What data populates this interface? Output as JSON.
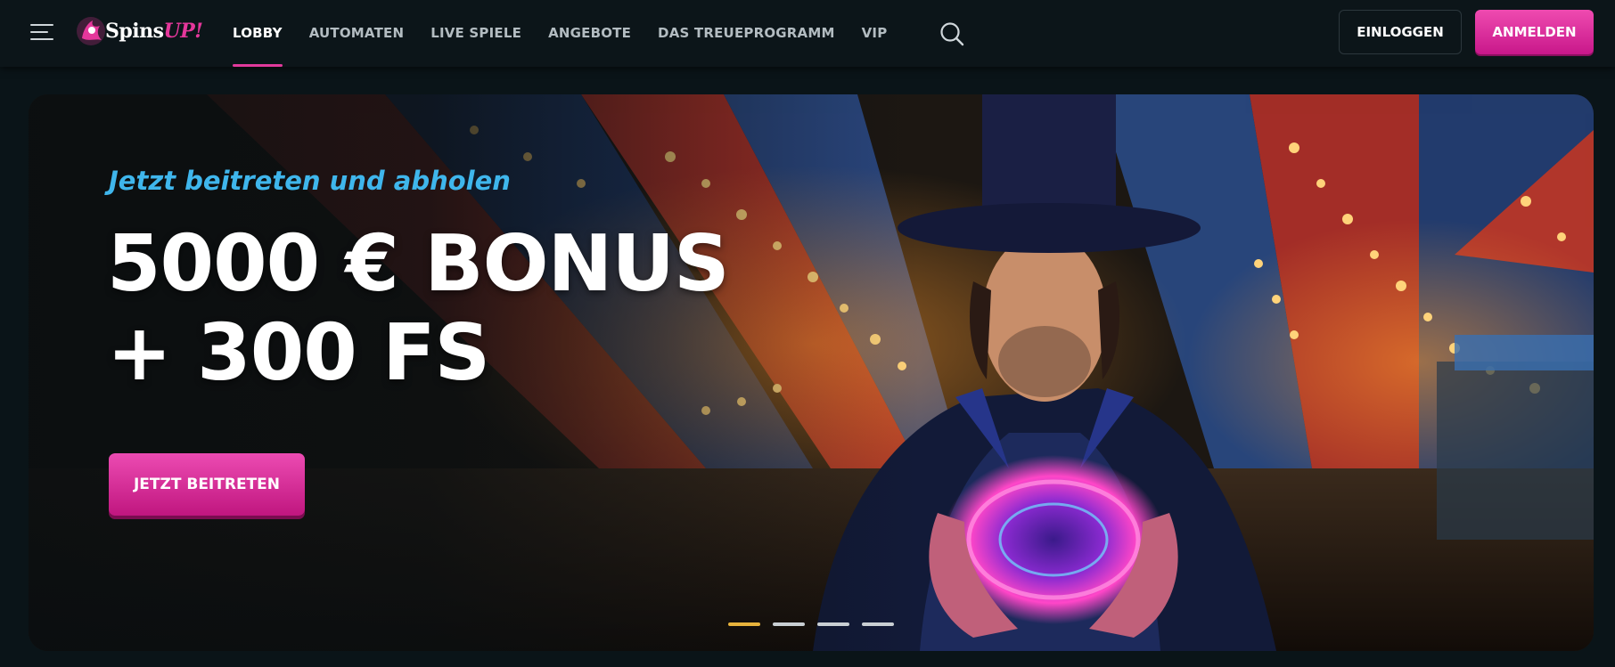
{
  "header": {
    "logo": {
      "text_main": "Spins",
      "text_accent": "UP!"
    },
    "nav": [
      {
        "label": "LOBBY",
        "active": true
      },
      {
        "label": "AUTOMATEN",
        "active": false
      },
      {
        "label": "LIVE SPIELE",
        "active": false
      },
      {
        "label": "ANGEBOTE",
        "active": false
      },
      {
        "label": "DAS TREUEPROGRAMM",
        "active": false
      },
      {
        "label": "VIP",
        "active": false
      }
    ],
    "login_label": "EINLOGGEN",
    "register_label": "ANMELDEN"
  },
  "hero": {
    "subtitle": "Jetzt beitreten und abholen",
    "headline_line1": "5000 € BONUS",
    "headline_line2": "+ 300 FS",
    "cta_label": "JETZT BEITRETEN",
    "slides_total": 4,
    "active_slide": 1
  },
  "colors": {
    "accent_pink": "#e23a9c",
    "subtitle_blue": "#3fb6ec",
    "header_bg": "#0c1519",
    "page_bg": "#0a1418",
    "slide_indicator_active": "#e8b33c"
  },
  "icons": [
    "menu-icon",
    "logo-icon",
    "search-icon"
  ]
}
